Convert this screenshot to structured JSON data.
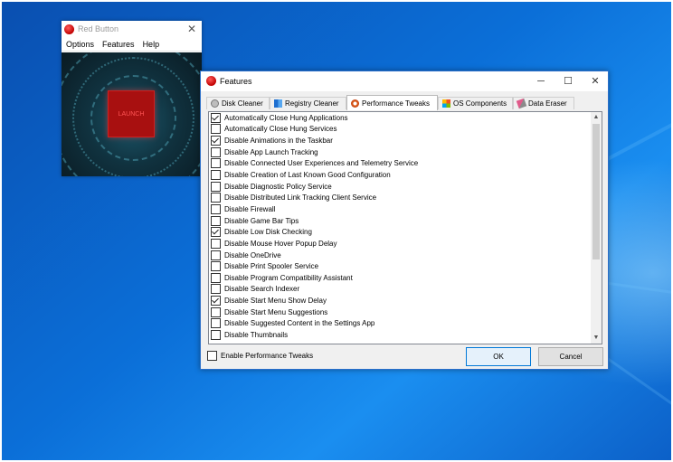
{
  "red_button": {
    "title": "Red Button",
    "menu": [
      "Options",
      "Features",
      "Help"
    ],
    "launch_label": "LAUNCH"
  },
  "features": {
    "title": "Features",
    "tabs": [
      {
        "label": "Disk Cleaner",
        "icon": "disk-icon",
        "active": false
      },
      {
        "label": "Registry Cleaner",
        "icon": "registry-icon",
        "active": false
      },
      {
        "label": "Performance Tweaks",
        "icon": "gauge-icon",
        "active": true
      },
      {
        "label": "OS Components",
        "icon": "windows-icon",
        "active": false
      },
      {
        "label": "Data Eraser",
        "icon": "eraser-icon",
        "active": false
      }
    ],
    "items": [
      {
        "label": "Automatically Close Hung Applications",
        "checked": true
      },
      {
        "label": "Automatically Close Hung Services",
        "checked": false
      },
      {
        "label": "Disable Animations in the Taskbar",
        "checked": true
      },
      {
        "label": "Disable App Launch Tracking",
        "checked": false
      },
      {
        "label": "Disable Connected User Experiences and Telemetry Service",
        "checked": false
      },
      {
        "label": "Disable Creation of Last Known Good Configuration",
        "checked": false
      },
      {
        "label": "Disable Diagnostic Policy Service",
        "checked": false
      },
      {
        "label": "Disable Distributed Link Tracking Client Service",
        "checked": false
      },
      {
        "label": "Disable Firewall",
        "checked": false
      },
      {
        "label": "Disable Game Bar Tips",
        "checked": false
      },
      {
        "label": "Disable Low Disk Checking",
        "checked": true
      },
      {
        "label": "Disable Mouse Hover Popup Delay",
        "checked": false
      },
      {
        "label": "Disable OneDrive",
        "checked": false
      },
      {
        "label": "Disable Print Spooler Service",
        "checked": false
      },
      {
        "label": "Disable Program Compatibility Assistant",
        "checked": false
      },
      {
        "label": "Disable Search Indexer",
        "checked": false
      },
      {
        "label": "Disable Start Menu Show Delay",
        "checked": true
      },
      {
        "label": "Disable Start Menu Suggestions",
        "checked": false
      },
      {
        "label": "Disable Suggested Content in the Settings App",
        "checked": false
      },
      {
        "label": "Disable Thumbnails",
        "checked": false
      }
    ],
    "enable_label": "Enable Performance Tweaks",
    "enable_checked": false,
    "ok_label": "OK",
    "cancel_label": "Cancel"
  }
}
